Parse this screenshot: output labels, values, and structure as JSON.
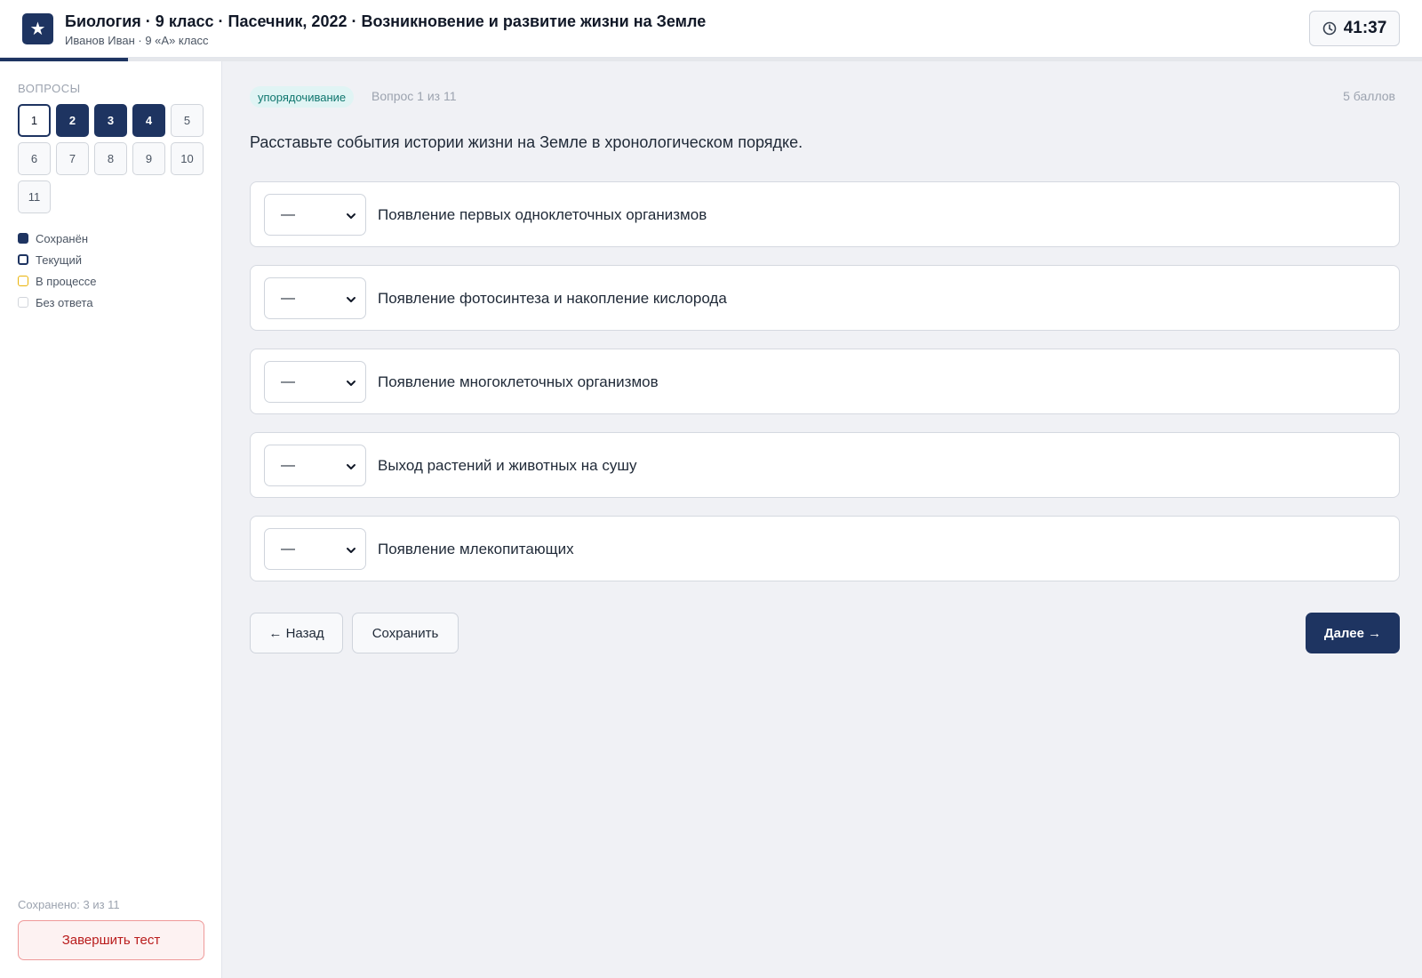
{
  "header": {
    "logo_glyph": "★",
    "title": "Биология · 9 класс · Пасечник, 2022 · Возникновение и развитие жизни на Земле",
    "subtitle": "Иванов Иван · 9 «А» класс",
    "timer": "41:37",
    "timer_icon": "clock-icon"
  },
  "progress": {
    "fraction": 0.09
  },
  "sidebar": {
    "heading": "Вопросы",
    "questions": [
      {
        "label": "1",
        "state": "current"
      },
      {
        "label": "2",
        "state": "saved"
      },
      {
        "label": "3",
        "state": "saved"
      },
      {
        "label": "4",
        "state": "saved"
      },
      {
        "label": "5",
        "state": "empty"
      },
      {
        "label": "6",
        "state": "empty"
      },
      {
        "label": "7",
        "state": "empty"
      },
      {
        "label": "8",
        "state": "empty"
      },
      {
        "label": "9",
        "state": "empty"
      },
      {
        "label": "10",
        "state": "empty"
      },
      {
        "label": "11",
        "state": "empty"
      }
    ],
    "legend": {
      "saved": "Сохранён",
      "current": "Текущий",
      "in_progress": "В процессе",
      "no_answer": "Без ответа"
    },
    "saved_count": "Сохранено: 3 из 11",
    "finish_label": "Завершить тест"
  },
  "question": {
    "type_badge": "упорядочивание",
    "number": "Вопрос 1 из 11",
    "points": "5 баллов",
    "text": "Расставьте события истории жизни на Земле в хронологическом порядке.",
    "items": [
      {
        "order": "—",
        "label": "Появление первых одноклеточных организмов"
      },
      {
        "order": "—",
        "label": "Появление фотосинтеза и накопление кислорода"
      },
      {
        "order": "—",
        "label": "Появление многоклеточных организмов"
      },
      {
        "order": "—",
        "label": "Выход растений и животных на сушу"
      },
      {
        "order": "—",
        "label": "Появление млекопитающих"
      }
    ]
  },
  "actions": {
    "back_label": "← Назад",
    "save_label": "Сохранить",
    "next_label": "Далее →"
  },
  "colors": {
    "primary": "#1e3461",
    "accent_badge": "#0f766e",
    "danger": "#b91c1c",
    "in_progress": "#eab308"
  }
}
